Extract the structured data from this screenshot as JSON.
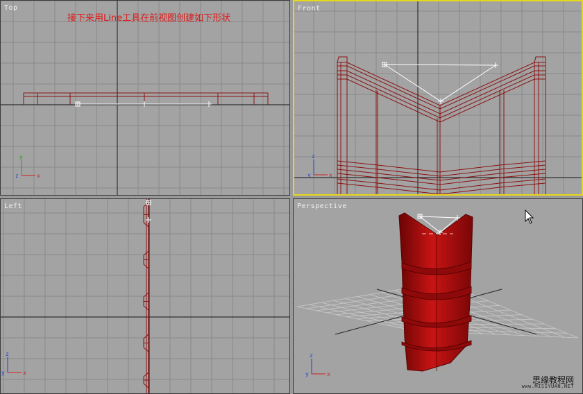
{
  "viewports": {
    "top": {
      "label": "Top"
    },
    "front": {
      "label": "Front"
    },
    "left": {
      "label": "Left"
    },
    "perspective": {
      "label": "Perspective"
    }
  },
  "instruction": "接下来用Line工具在前视图创建如下形状",
  "axis": {
    "x": "x",
    "y": "y",
    "z": "z"
  },
  "watermark": {
    "cn": "思缘教程网",
    "url": "www.MISSYUAN.NET"
  },
  "colors": {
    "viewport_bg": "#a3a3a3",
    "grid": "#8a8a8a",
    "axis_line": "#303030",
    "wire": "#8c1010",
    "spline": "#ffffff",
    "active_border": "#e8d81c",
    "note": "#e01818"
  }
}
